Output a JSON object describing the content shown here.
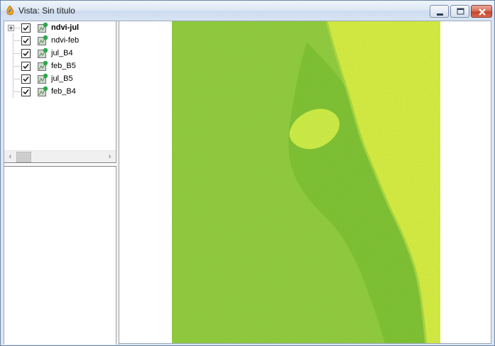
{
  "window": {
    "title": "Vista: Sin título",
    "icon": "gvsig-app-icon",
    "controls": [
      "minimize-icon",
      "maximize-icon",
      "close-icon"
    ]
  },
  "toc": {
    "layers": [
      {
        "label": "ndvi-jul",
        "checked": true,
        "bold": true,
        "expandable": true
      },
      {
        "label": "ndvi-feb",
        "checked": true,
        "bold": false,
        "expandable": false
      },
      {
        "label": "jul_B4",
        "checked": true,
        "bold": false,
        "expandable": false
      },
      {
        "label": "feb_B5",
        "checked": true,
        "bold": false,
        "expandable": false
      },
      {
        "label": "jul_B5",
        "checked": true,
        "bold": false,
        "expandable": false
      },
      {
        "label": "feb_B4",
        "checked": true,
        "bold": false,
        "expandable": false
      }
    ],
    "scroll_left": "‹",
    "scroll_right": "›"
  },
  "map": {
    "colors": {
      "land": "#8cc83c",
      "coast_marsh": "#78bc30",
      "sea": "#d4ea40",
      "lagoon": "#ccea44",
      "background": "#ffffff"
    }
  }
}
